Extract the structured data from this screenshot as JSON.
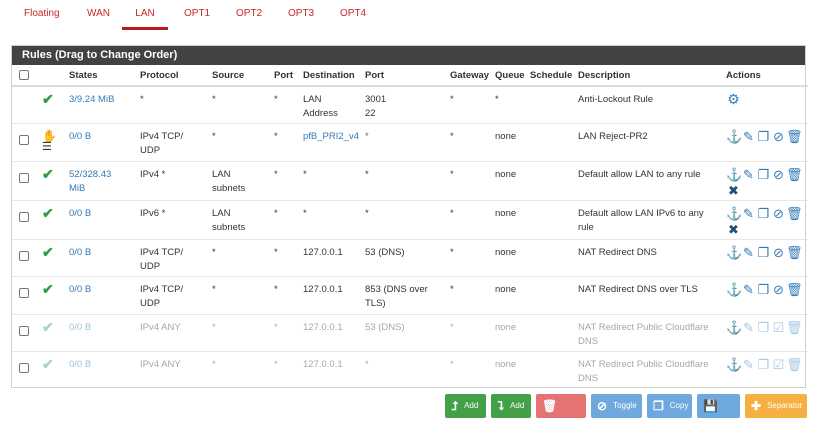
{
  "tabs": [
    {
      "label": "Floating",
      "active": false
    },
    {
      "label": "WAN",
      "active": false
    },
    {
      "label": "LAN",
      "active": true
    },
    {
      "label": "OPT1",
      "active": false
    },
    {
      "label": "OPT2",
      "active": false
    },
    {
      "label": "OPT3",
      "active": false
    },
    {
      "label": "OPT4",
      "active": false
    }
  ],
  "panel": {
    "title": "Rules (Drag to Change Order)"
  },
  "columns": {
    "states": "States",
    "protocol": "Protocol",
    "source": "Source",
    "port": "Port",
    "destination": "Destination",
    "dport": "Port",
    "gateway": "Gateway",
    "queue": "Queue",
    "schedule": "Schedule",
    "description": "Description",
    "actions": "Actions"
  },
  "rows": [
    {
      "states": "3/9.24 MiB",
      "protocol": "*",
      "source": "*",
      "port": "*",
      "destination": "LAN Address",
      "dport": "3001\n22",
      "gateway": "*",
      "queue": "*",
      "schedule": "",
      "description": "Anti-Lockout Rule"
    },
    {
      "states": "0/0 B",
      "protocol": "IPv4 TCP/ UDP",
      "source": "*",
      "port": "*",
      "destination": "pfB_PRI2_v4",
      "dport": "*",
      "gateway": "*",
      "queue": "none",
      "schedule": "",
      "description": "LAN Reject-PR2"
    },
    {
      "states": "52/328.43 MiB",
      "protocol": "IPv4 *",
      "source": "LAN subnets",
      "port": "*",
      "destination": "*",
      "dport": "*",
      "gateway": "*",
      "queue": "none",
      "schedule": "",
      "description": "Default allow LAN to any rule"
    },
    {
      "states": "0/0 B",
      "protocol": "IPv6 *",
      "source": "LAN subnets",
      "port": "*",
      "destination": "*",
      "dport": "*",
      "gateway": "*",
      "queue": "none",
      "schedule": "",
      "description": "Default allow LAN IPv6 to any rule"
    },
    {
      "states": "0/0 B",
      "protocol": "IPv4 TCP/ UDP",
      "source": "*",
      "port": "*",
      "destination": "127.0.0.1",
      "dport": "53 (DNS)",
      "gateway": "*",
      "queue": "none",
      "schedule": "",
      "description": "NAT Redirect DNS"
    },
    {
      "states": "0/0 B",
      "protocol": "IPv4 TCP/ UDP",
      "source": "*",
      "port": "*",
      "destination": "127.0.0.1",
      "dport": "853 (DNS over TLS)",
      "gateway": "*",
      "queue": "none",
      "schedule": "",
      "description": "NAT Redirect DNS over TLS"
    },
    {
      "states": "0/0 B",
      "protocol": "IPv4 ANY",
      "source": "*",
      "port": "*",
      "destination": "127.0.0.1",
      "dport": "53 (DNS)",
      "gateway": "*",
      "queue": "none",
      "schedule": "",
      "description": "NAT Redirect Public Cloudflare DNS"
    },
    {
      "states": "0/0 B",
      "protocol": "IPv4 ANY",
      "source": "*",
      "port": "*",
      "destination": "127.0.0.1",
      "dport": "*",
      "gateway": "*",
      "queue": "none",
      "schedule": "",
      "description": "NAT Redirect Public Cloudflare DNS"
    }
  ],
  "buttons": {
    "add_top": "Add",
    "add_bottom": "Add",
    "delete": "Delete",
    "toggle": "Toggle",
    "copy": "Copy",
    "save": "Save",
    "separator": "Separator"
  },
  "colors": {
    "accent_red": "#c62828",
    "green": "#43a047",
    "blue": "#337ab7",
    "header_bg": "#424242"
  }
}
